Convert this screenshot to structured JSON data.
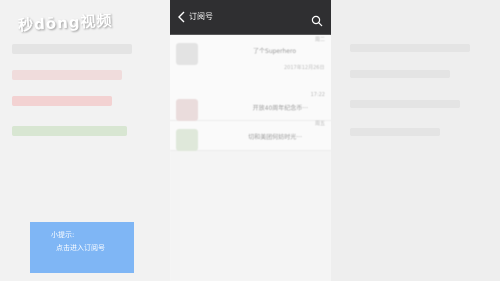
{
  "watermark": {
    "text": "秒dōng视频"
  },
  "navbar": {
    "title": "订阅号",
    "back_icon": "chevron-left-icon",
    "search_icon": "search-icon"
  },
  "articles": [
    {
      "time": "周二",
      "snippet": "了个Superhero"
    },
    {
      "date": "2017年12月26日"
    },
    {
      "time": "17:22",
      "snippet": "开放40周年纪念币···"
    },
    {
      "time": "周五",
      "snippet": "切和美团何妨时光···"
    }
  ],
  "tip": {
    "line1": "小提示:",
    "line2": "点击进入订阅号"
  },
  "colors": {
    "navbar": "#2f2f31",
    "tip": "#7fb6f5"
  }
}
